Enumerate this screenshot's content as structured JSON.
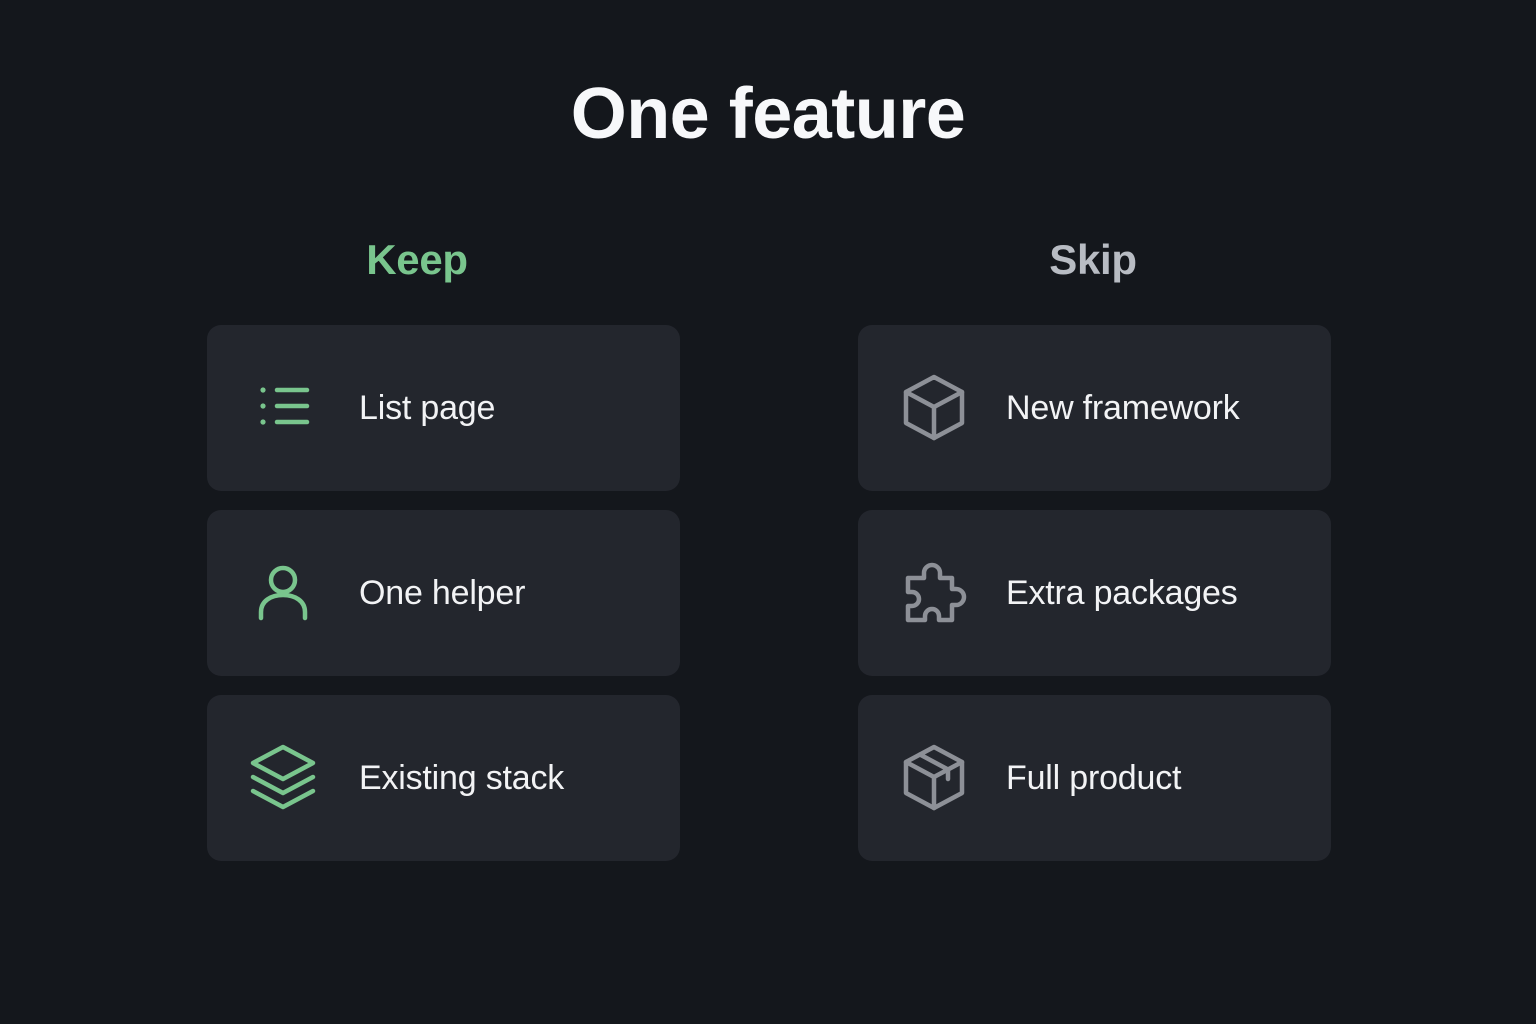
{
  "title": "One feature",
  "colors": {
    "background": "#14171c",
    "card": "#23262d",
    "keep_accent": "#79c58d",
    "skip_accent": "#8d9097",
    "text": "#f2f3f5"
  },
  "keep": {
    "heading": "Keep",
    "items": [
      {
        "label": "List page",
        "icon": "list-icon"
      },
      {
        "label": "One helper",
        "icon": "user-icon"
      },
      {
        "label": "Existing stack",
        "icon": "layers-icon"
      }
    ]
  },
  "skip": {
    "heading": "Skip",
    "items": [
      {
        "label": "New framework",
        "icon": "cube-icon"
      },
      {
        "label": "Extra packages",
        "icon": "puzzle-icon"
      },
      {
        "label": "Full product",
        "icon": "package-icon"
      }
    ]
  }
}
